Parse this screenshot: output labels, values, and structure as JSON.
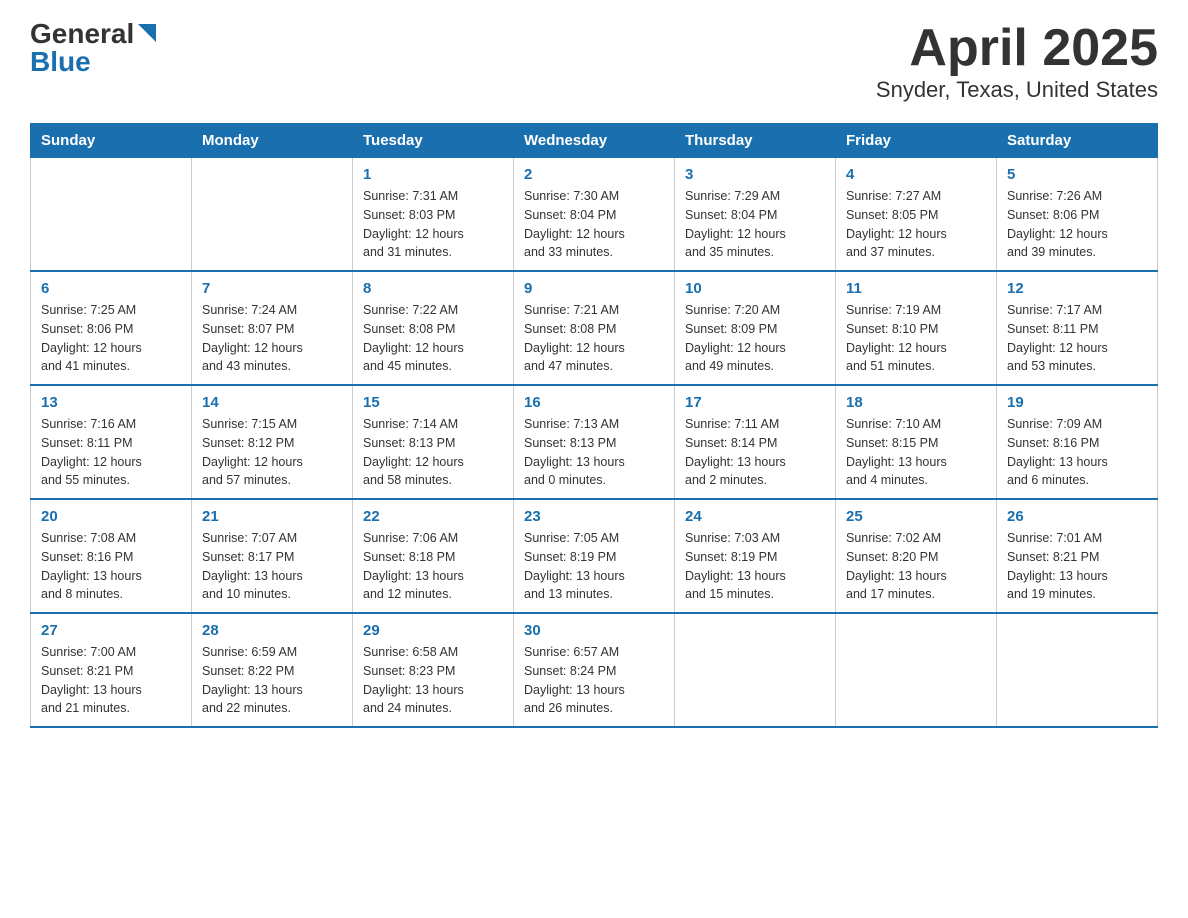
{
  "header": {
    "logo_general": "General",
    "logo_blue": "Blue",
    "title": "April 2025",
    "subtitle": "Snyder, Texas, United States"
  },
  "days_of_week": [
    "Sunday",
    "Monday",
    "Tuesday",
    "Wednesday",
    "Thursday",
    "Friday",
    "Saturday"
  ],
  "weeks": [
    [
      {
        "day": "",
        "info": ""
      },
      {
        "day": "",
        "info": ""
      },
      {
        "day": "1",
        "info": "Sunrise: 7:31 AM\nSunset: 8:03 PM\nDaylight: 12 hours\nand 31 minutes."
      },
      {
        "day": "2",
        "info": "Sunrise: 7:30 AM\nSunset: 8:04 PM\nDaylight: 12 hours\nand 33 minutes."
      },
      {
        "day": "3",
        "info": "Sunrise: 7:29 AM\nSunset: 8:04 PM\nDaylight: 12 hours\nand 35 minutes."
      },
      {
        "day": "4",
        "info": "Sunrise: 7:27 AM\nSunset: 8:05 PM\nDaylight: 12 hours\nand 37 minutes."
      },
      {
        "day": "5",
        "info": "Sunrise: 7:26 AM\nSunset: 8:06 PM\nDaylight: 12 hours\nand 39 minutes."
      }
    ],
    [
      {
        "day": "6",
        "info": "Sunrise: 7:25 AM\nSunset: 8:06 PM\nDaylight: 12 hours\nand 41 minutes."
      },
      {
        "day": "7",
        "info": "Sunrise: 7:24 AM\nSunset: 8:07 PM\nDaylight: 12 hours\nand 43 minutes."
      },
      {
        "day": "8",
        "info": "Sunrise: 7:22 AM\nSunset: 8:08 PM\nDaylight: 12 hours\nand 45 minutes."
      },
      {
        "day": "9",
        "info": "Sunrise: 7:21 AM\nSunset: 8:08 PM\nDaylight: 12 hours\nand 47 minutes."
      },
      {
        "day": "10",
        "info": "Sunrise: 7:20 AM\nSunset: 8:09 PM\nDaylight: 12 hours\nand 49 minutes."
      },
      {
        "day": "11",
        "info": "Sunrise: 7:19 AM\nSunset: 8:10 PM\nDaylight: 12 hours\nand 51 minutes."
      },
      {
        "day": "12",
        "info": "Sunrise: 7:17 AM\nSunset: 8:11 PM\nDaylight: 12 hours\nand 53 minutes."
      }
    ],
    [
      {
        "day": "13",
        "info": "Sunrise: 7:16 AM\nSunset: 8:11 PM\nDaylight: 12 hours\nand 55 minutes."
      },
      {
        "day": "14",
        "info": "Sunrise: 7:15 AM\nSunset: 8:12 PM\nDaylight: 12 hours\nand 57 minutes."
      },
      {
        "day": "15",
        "info": "Sunrise: 7:14 AM\nSunset: 8:13 PM\nDaylight: 12 hours\nand 58 minutes."
      },
      {
        "day": "16",
        "info": "Sunrise: 7:13 AM\nSunset: 8:13 PM\nDaylight: 13 hours\nand 0 minutes."
      },
      {
        "day": "17",
        "info": "Sunrise: 7:11 AM\nSunset: 8:14 PM\nDaylight: 13 hours\nand 2 minutes."
      },
      {
        "day": "18",
        "info": "Sunrise: 7:10 AM\nSunset: 8:15 PM\nDaylight: 13 hours\nand 4 minutes."
      },
      {
        "day": "19",
        "info": "Sunrise: 7:09 AM\nSunset: 8:16 PM\nDaylight: 13 hours\nand 6 minutes."
      }
    ],
    [
      {
        "day": "20",
        "info": "Sunrise: 7:08 AM\nSunset: 8:16 PM\nDaylight: 13 hours\nand 8 minutes."
      },
      {
        "day": "21",
        "info": "Sunrise: 7:07 AM\nSunset: 8:17 PM\nDaylight: 13 hours\nand 10 minutes."
      },
      {
        "day": "22",
        "info": "Sunrise: 7:06 AM\nSunset: 8:18 PM\nDaylight: 13 hours\nand 12 minutes."
      },
      {
        "day": "23",
        "info": "Sunrise: 7:05 AM\nSunset: 8:19 PM\nDaylight: 13 hours\nand 13 minutes."
      },
      {
        "day": "24",
        "info": "Sunrise: 7:03 AM\nSunset: 8:19 PM\nDaylight: 13 hours\nand 15 minutes."
      },
      {
        "day": "25",
        "info": "Sunrise: 7:02 AM\nSunset: 8:20 PM\nDaylight: 13 hours\nand 17 minutes."
      },
      {
        "day": "26",
        "info": "Sunrise: 7:01 AM\nSunset: 8:21 PM\nDaylight: 13 hours\nand 19 minutes."
      }
    ],
    [
      {
        "day": "27",
        "info": "Sunrise: 7:00 AM\nSunset: 8:21 PM\nDaylight: 13 hours\nand 21 minutes."
      },
      {
        "day": "28",
        "info": "Sunrise: 6:59 AM\nSunset: 8:22 PM\nDaylight: 13 hours\nand 22 minutes."
      },
      {
        "day": "29",
        "info": "Sunrise: 6:58 AM\nSunset: 8:23 PM\nDaylight: 13 hours\nand 24 minutes."
      },
      {
        "day": "30",
        "info": "Sunrise: 6:57 AM\nSunset: 8:24 PM\nDaylight: 13 hours\nand 26 minutes."
      },
      {
        "day": "",
        "info": ""
      },
      {
        "day": "",
        "info": ""
      },
      {
        "day": "",
        "info": ""
      }
    ]
  ]
}
